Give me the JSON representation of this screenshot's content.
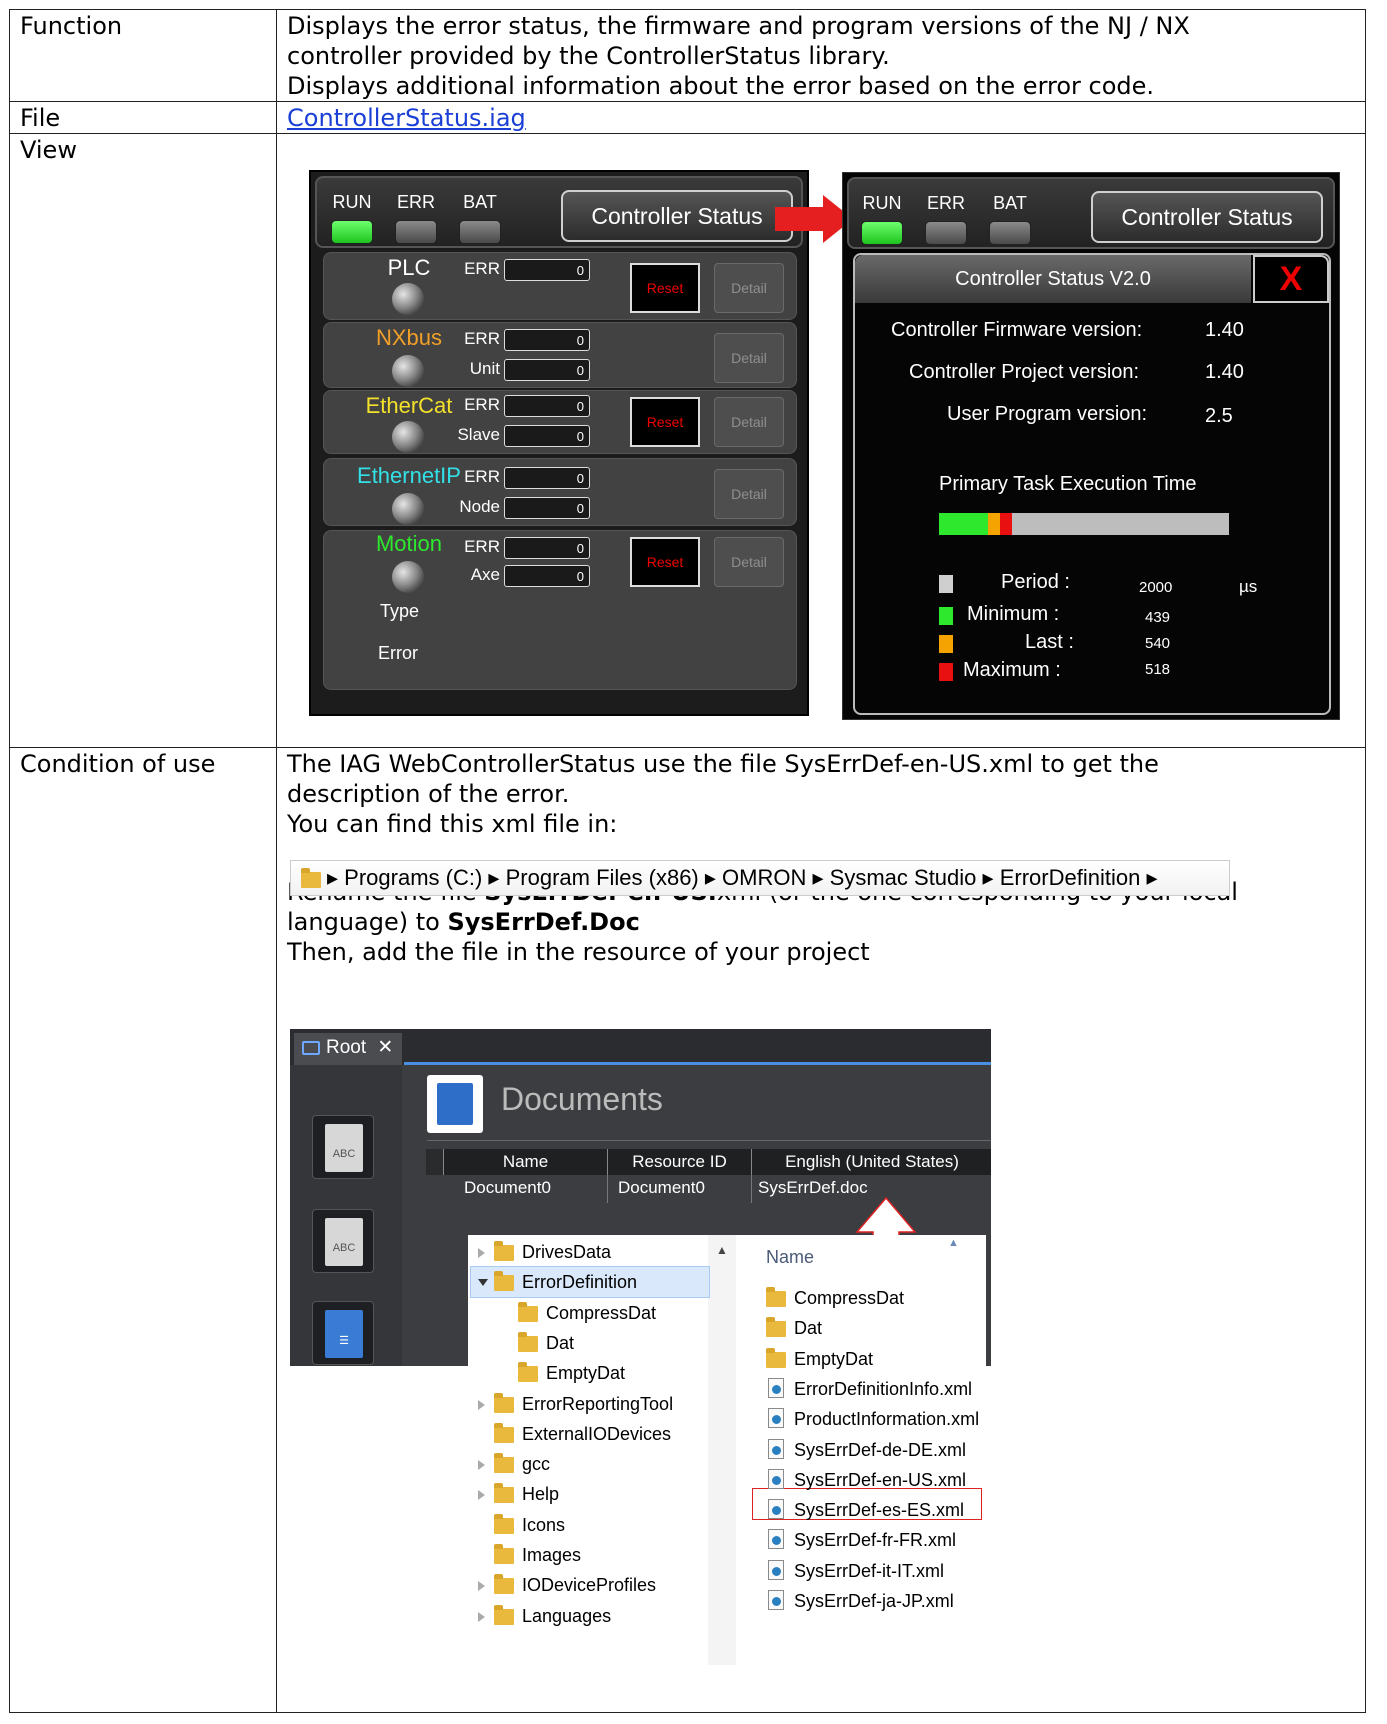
{
  "rows": {
    "function": {
      "label": "Function",
      "line1": "Displays the error status, the firmware and program versions of the NJ / NX",
      "line2": "controller provided by the ControllerStatus library.",
      "line3": "Displays additional information about the error based on the error code."
    },
    "file": {
      "label": "File",
      "link": "ControllerStatus.iag"
    },
    "view": {
      "label": "View"
    },
    "condition": {
      "label": "Condition of use",
      "p1a": "The IAG WebControllerStatus use the file SysErrDef-en-US.xml to get the",
      "p1b": "description of the error.",
      "p2": "You can find this xml file in:",
      "p3_pre": "Rename the file ",
      "p3_bold1": "SysErrDef-en-US.",
      "p3_mid": "xml (or the one corresponding to your local",
      "p3_line2_pre": "language) to ",
      "p3_bold2": "SysErrDef.Doc",
      "p4": "Then, add the file in the resource of your project"
    }
  },
  "left_panel": {
    "indicators": [
      {
        "label": "RUN",
        "state": "on"
      },
      {
        "label": "ERR",
        "state": "off"
      },
      {
        "label": "BAT",
        "state": "off"
      }
    ],
    "status_button": "Controller Status",
    "groups": [
      {
        "name": "PLC",
        "color": "#ffffff",
        "fields": [
          {
            "label": "ERR",
            "value": "0"
          }
        ],
        "reset": "Reset",
        "detail": "Detail"
      },
      {
        "name": "NXbus",
        "color": "#f0a028",
        "fields": [
          {
            "label": "ERR",
            "value": "0"
          },
          {
            "label": "Unit",
            "value": "0"
          }
        ],
        "detail": "Detail"
      },
      {
        "name": "EtherCat",
        "color": "#f2e02a",
        "fields": [
          {
            "label": "ERR",
            "value": "0"
          },
          {
            "label": "Slave",
            "value": "0"
          }
        ],
        "reset": "Reset",
        "detail": "Detail"
      },
      {
        "name": "EthernetIP",
        "color": "#32e0e8",
        "fields": [
          {
            "label": "ERR",
            "value": "0"
          },
          {
            "label": "Node",
            "value": "0"
          }
        ],
        "detail": "Detail"
      },
      {
        "name": "Motion",
        "color": "#2ee82e",
        "fields": [
          {
            "label": "ERR",
            "value": "0"
          },
          {
            "label": "Axe",
            "value": "0"
          }
        ],
        "reset": "Reset",
        "detail": "Detail",
        "extra": [
          "Type",
          "Error"
        ]
      }
    ]
  },
  "right_panel": {
    "indicators": [
      {
        "label": "RUN",
        "state": "on"
      },
      {
        "label": "ERR",
        "state": "off"
      },
      {
        "label": "BAT",
        "state": "off"
      }
    ],
    "status_button": "Controller Status",
    "header": "Controller Status V2.0",
    "close": "X",
    "versions": [
      {
        "label": "Controller Firmware version:",
        "value": "1.40"
      },
      {
        "label": "Controller Project  version:",
        "value": "1.40"
      },
      {
        "label": "User Program  version:",
        "value": "2.5"
      }
    ],
    "exec_title": "Primary Task Execution Time",
    "exec_bar": {
      "minimum_fraction": 0.185,
      "last_fraction": 0.045,
      "maximum_fraction": 0.045
    },
    "legend": [
      {
        "label": "Period :",
        "value": "2000",
        "unit": "µs",
        "color": "#cfcfcf"
      },
      {
        "label": "Minimum :",
        "value": "439",
        "color": "#2ee82e"
      },
      {
        "label": "Last :",
        "value": "540",
        "color": "#f5a300"
      },
      {
        "label": "Maximum :",
        "value": "518",
        "color": "#e81010"
      }
    ]
  },
  "breadcrumb": [
    "Programs (C:)",
    "Program Files (x86)",
    "OMRON",
    "Sysmac Studio",
    "ErrorDefinition"
  ],
  "ide": {
    "tab": "Root",
    "title": "Documents",
    "side_icons": [
      "ABC",
      "ABC"
    ],
    "columns": [
      "Name",
      "Resource ID",
      "English (United States)"
    ],
    "row": [
      "Document0",
      "Document0",
      "SysErrDef.doc"
    ]
  },
  "explorer": {
    "tree": [
      {
        "name": "DrivesData",
        "expand": "closed",
        "indent": 0
      },
      {
        "name": "ErrorDefinition",
        "expand": "open",
        "indent": 0,
        "selected": true
      },
      {
        "name": "CompressDat",
        "expand": "none",
        "indent": 1
      },
      {
        "name": "Dat",
        "expand": "none",
        "indent": 1
      },
      {
        "name": "EmptyDat",
        "expand": "none",
        "indent": 1
      },
      {
        "name": "ErrorReportingTool",
        "expand": "closed",
        "indent": 0
      },
      {
        "name": "ExternalIODevices",
        "expand": "none",
        "indent": 0
      },
      {
        "name": "gcc",
        "expand": "closed",
        "indent": 0
      },
      {
        "name": "Help",
        "expand": "closed",
        "indent": 0
      },
      {
        "name": "Icons",
        "expand": "none",
        "indent": 0
      },
      {
        "name": "Images",
        "expand": "none",
        "indent": 0
      },
      {
        "name": "IODeviceProfiles",
        "expand": "closed",
        "indent": 0
      },
      {
        "name": "Languages",
        "expand": "closed",
        "indent": 0
      }
    ],
    "column_header": "Name",
    "files": [
      {
        "name": "CompressDat",
        "type": "folder"
      },
      {
        "name": "Dat",
        "type": "folder"
      },
      {
        "name": "EmptyDat",
        "type": "folder"
      },
      {
        "name": "ErrorDefinitionInfo.xml",
        "type": "xml"
      },
      {
        "name": "ProductInformation.xml",
        "type": "xml"
      },
      {
        "name": "SysErrDef-de-DE.xml",
        "type": "xml"
      },
      {
        "name": "SysErrDef-en-US.xml",
        "type": "xml",
        "highlighted": true
      },
      {
        "name": "SysErrDef-es-ES.xml",
        "type": "xml"
      },
      {
        "name": "SysErrDef-fr-FR.xml",
        "type": "xml"
      },
      {
        "name": "SysErrDef-it-IT.xml",
        "type": "xml"
      },
      {
        "name": "SysErrDef-ja-JP.xml",
        "type": "xml"
      }
    ]
  }
}
